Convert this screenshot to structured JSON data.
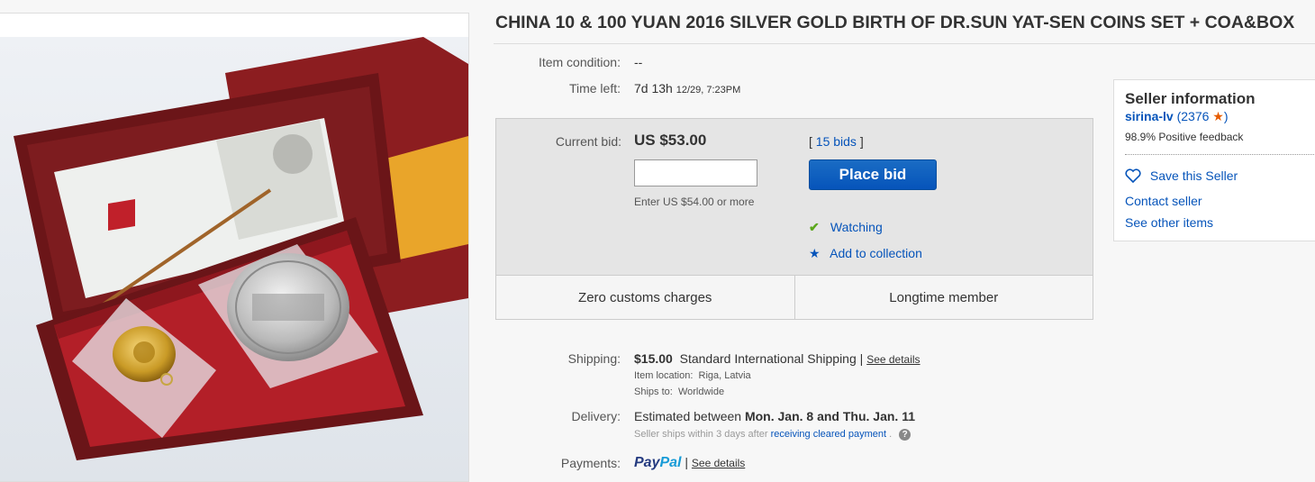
{
  "title": "CHINA 10 & 100 YUAN 2016 SILVER GOLD BIRTH OF DR.SUN YAT-SEN COINS SET + COA&BOX",
  "item_condition": {
    "label": "Item condition:",
    "value": "--"
  },
  "time_left": {
    "label": "Time left:",
    "value": "7d 13h",
    "end": "12/29, 7:23PM"
  },
  "bid": {
    "label": "Current bid:",
    "price": "US $53.00",
    "bids_open": "[",
    "bids_link": "15 bids",
    "bids_close": "]",
    "input_value": "",
    "hint": "Enter US $54.00 or more",
    "place_bid": "Place bid",
    "watching": "Watching",
    "add_collection": "Add to collection",
    "badge_customs": "Zero customs charges",
    "badge_member": "Longtime member"
  },
  "shipping": {
    "label": "Shipping:",
    "cost": "$15.00",
    "method": "Standard International Shipping",
    "sep": "|",
    "details": "See details",
    "location_label": "Item location:",
    "location": "Riga, Latvia",
    "ships_label": "Ships to:",
    "ships_to": "Worldwide"
  },
  "delivery": {
    "label": "Delivery:",
    "prefix": "Estimated between",
    "range": "Mon. Jan. 8 and Thu. Jan. 11",
    "note_prefix": "Seller ships within 3 days after",
    "note_link": "receiving cleared payment",
    "note_suffix": "."
  },
  "payments": {
    "label": "Payments:",
    "brand_pay": "Pay",
    "brand_pal": "Pal",
    "sep": "|",
    "details": "See details"
  },
  "seller": {
    "heading": "Seller information",
    "name": "sirina-lv",
    "score_open": "(2376",
    "score_close": ")",
    "feedback": "98.9% Positive feedback",
    "save": "Save this Seller",
    "contact": "Contact seller",
    "other": "See other items"
  },
  "colors": {
    "accent": "#0654ba",
    "watch_check": "#5ba71b",
    "star": "#e65c00",
    "paypal_dark": "#253b80",
    "paypal_light": "#179bd7"
  },
  "icons": [
    "check-icon",
    "star-icon",
    "heart-icon",
    "help-icon",
    "rating-star-icon"
  ]
}
